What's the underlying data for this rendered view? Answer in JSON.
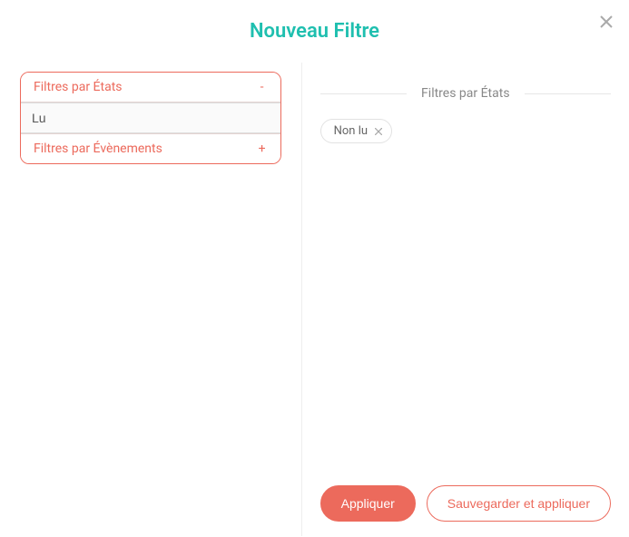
{
  "title": "Nouveau Filtre",
  "accordion": {
    "states": {
      "label": "Filtres par États",
      "toggle": "-",
      "input_value": "Lu"
    },
    "events": {
      "label": "Filtres par Évènements",
      "toggle": "+"
    }
  },
  "right": {
    "section_label": "Filtres par États",
    "chips": [
      {
        "label": "Non lu"
      }
    ]
  },
  "buttons": {
    "apply": "Appliquer",
    "save_apply": "Sauvegarder et appliquer"
  }
}
